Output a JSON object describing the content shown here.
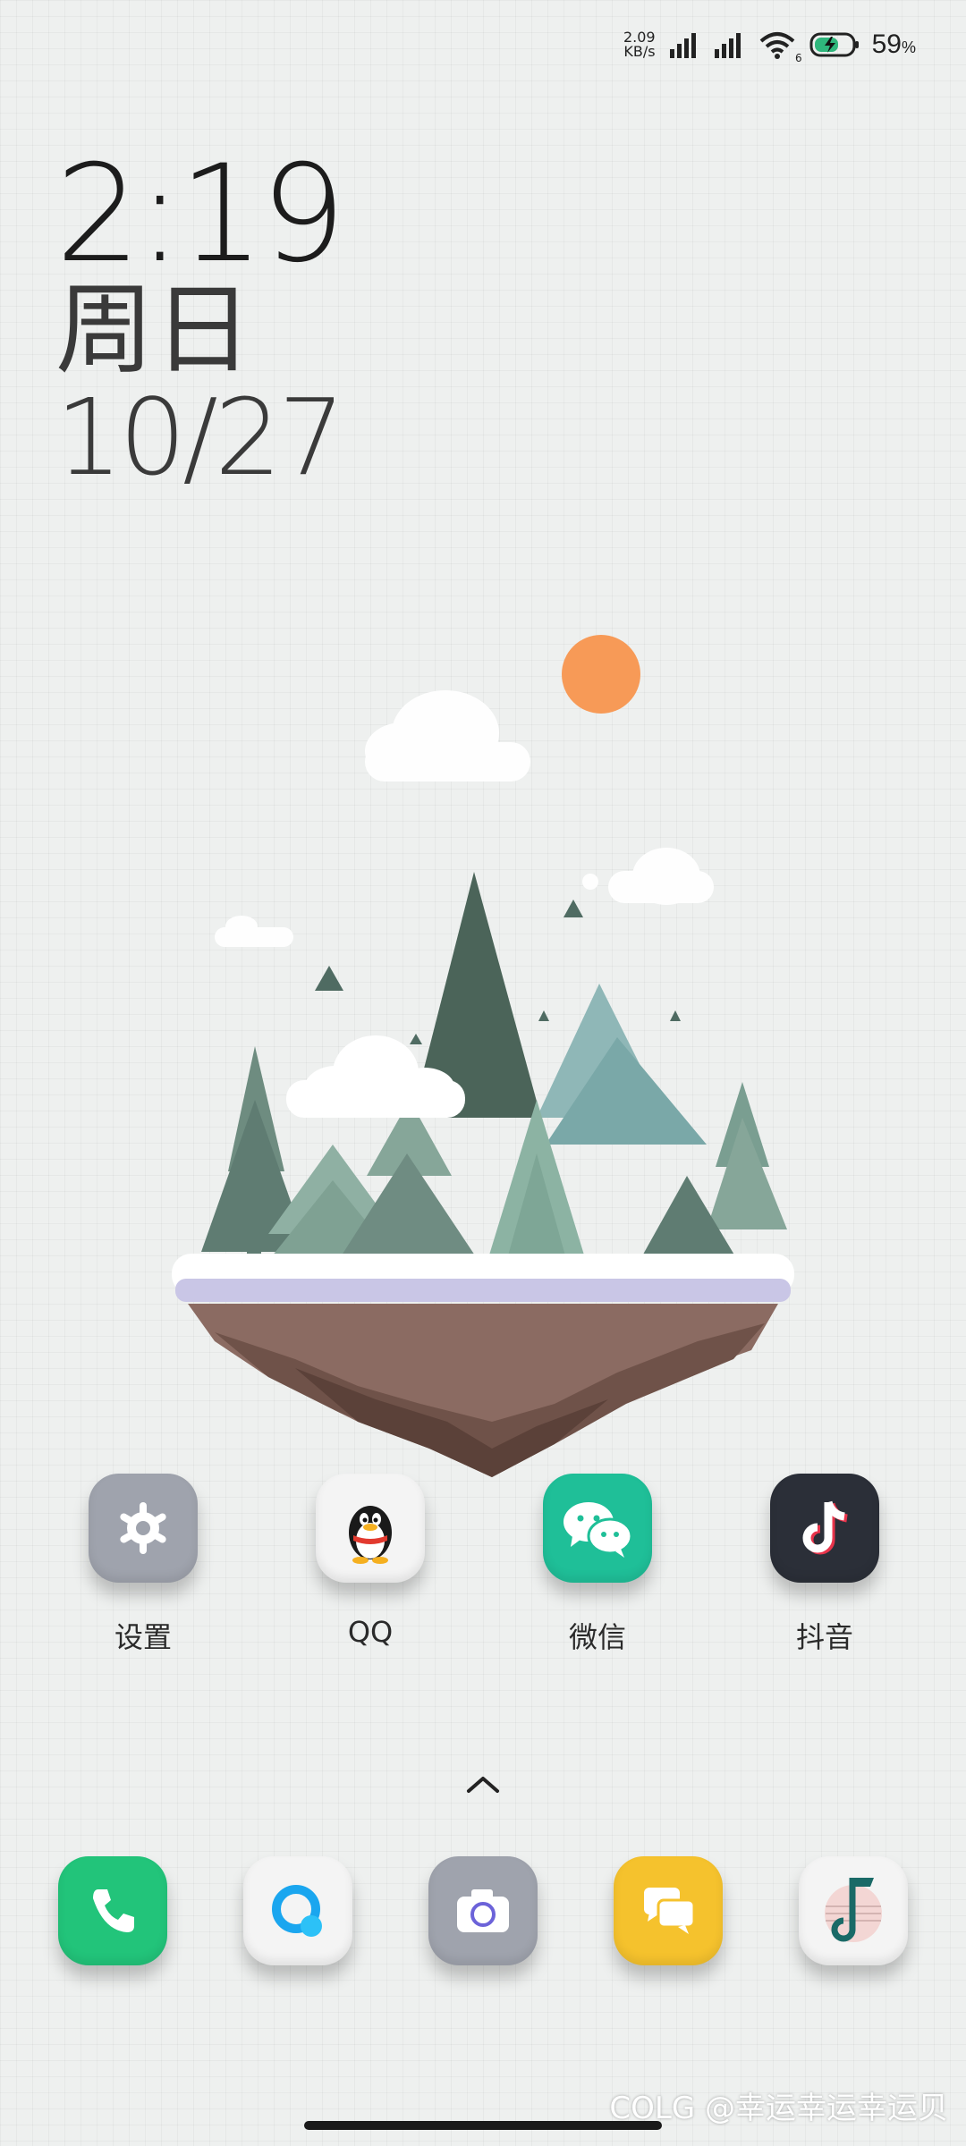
{
  "status_bar": {
    "net_speed_value": "2.09",
    "net_speed_unit": "KB/s",
    "wifi_badge": "6",
    "battery_percent": "59",
    "battery_percent_sign": "%",
    "icons": [
      "signal-icon",
      "signal-icon",
      "wifi-icon",
      "battery-charging-icon"
    ]
  },
  "clock": {
    "time": "2:19",
    "weekday": "周日",
    "date": "10/27"
  },
  "apps": [
    {
      "name": "设置",
      "icon": "settings-gear-icon",
      "color": "#9fa3ad"
    },
    {
      "name": "QQ",
      "icon": "qq-penguin-icon",
      "color": "#f4f4f4"
    },
    {
      "name": "微信",
      "icon": "wechat-icon",
      "color": "#1fbf98"
    },
    {
      "name": "抖音",
      "icon": "tiktok-icon",
      "color": "#2b2f38"
    }
  ],
  "dock": [
    {
      "icon": "phone-icon",
      "color": "#22c47a"
    },
    {
      "icon": "browser-icon",
      "color": "#f4f4f4"
    },
    {
      "icon": "camera-icon",
      "color": "#9fa3ad"
    },
    {
      "icon": "messages-icon",
      "color": "#f5c22d"
    },
    {
      "icon": "music-note-icon",
      "color": "#f4f4f4"
    }
  ],
  "watermark": "COLG @幸运幸运幸运贝"
}
